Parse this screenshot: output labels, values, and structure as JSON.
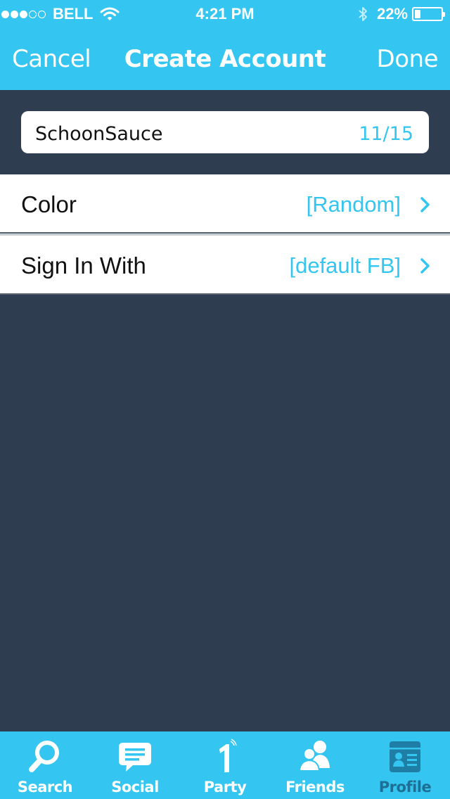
{
  "status_bar": {
    "carrier": "BELL",
    "signal_dots_filled": 3,
    "signal_dots_total": 5,
    "time": "4:21 PM",
    "battery_percent": "22%",
    "battery_level": 0.22
  },
  "nav": {
    "cancel_label": "Cancel",
    "title": "Create Account",
    "done_label": "Done"
  },
  "name_field": {
    "value": "SchoonSauce",
    "char_count": "11/15"
  },
  "settings_rows": [
    {
      "label": "Color",
      "value": "[Random]"
    },
    {
      "label": "Sign In With",
      "value": "[default FB]"
    }
  ],
  "tab_bar": {
    "active": "Profile",
    "tabs": [
      {
        "label": "Search",
        "icon": "search-icon"
      },
      {
        "label": "Social",
        "icon": "chat-bubble-icon"
      },
      {
        "label": "Party",
        "icon": "party-one-icon"
      },
      {
        "label": "Friends",
        "icon": "friends-icon"
      },
      {
        "label": "Profile",
        "icon": "profile-card-icon"
      }
    ]
  },
  "colors": {
    "accent": "#34c5f0",
    "background": "#2e3d50",
    "active_tab": "#1e7ea6"
  }
}
